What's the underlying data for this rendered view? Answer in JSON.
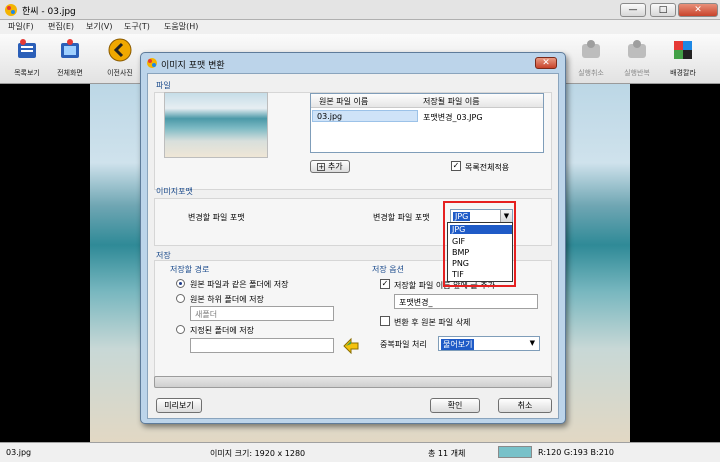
{
  "window": {
    "title": "한씨 - 03.jpg",
    "min_label": "—",
    "max_label": "□",
    "close_label": "✕"
  },
  "menu": [
    "파일(F)",
    "편집(E)",
    "보기(V)",
    "도구(T)",
    "도움말(H)"
  ],
  "toolbar": {
    "items": [
      {
        "label": "목록보기",
        "icon": "list-view-icon"
      },
      {
        "label": "전체화면",
        "icon": "fullscreen-icon"
      },
      {
        "label": "이전사진",
        "icon": "prev-photo-icon"
      },
      {
        "label": "실행취소",
        "icon": "undo-icon"
      },
      {
        "label": "실행반복",
        "icon": "redo-icon"
      },
      {
        "label": "배경칼라",
        "icon": "background-color-icon"
      }
    ]
  },
  "status": {
    "filename": "03.jpg",
    "image_size": "이미지 크기: 1920 x 1280",
    "count": "총 11 개체",
    "swatch_color": "#78c1c9",
    "rgb": "R:120 G:193 B:210"
  },
  "dialog": {
    "title": "이미지 포맷 변환",
    "close_label": "✕",
    "file_section": "파일",
    "list_headers": [
      "원본 파일 이름",
      "저장될 파일 이름"
    ],
    "list_rows": [
      {
        "source": "03.jpg",
        "target": "포맷변경_03.JPG"
      }
    ],
    "add_button": "추가",
    "add_plus": "+",
    "apply_all": {
      "label": "목록전체적용",
      "checked": "✓"
    },
    "format_section": "이미지포맷",
    "source_format_label": "변경할 파일 포맷",
    "target_format_label": "변경할 파일 포맷",
    "format_selected": "JPG",
    "format_options": [
      "JPG",
      "GIF",
      "BMP",
      "PNG",
      "TIF"
    ],
    "save_section": "저장",
    "save_path_title": "저장할 경로",
    "save_options": [
      "원본 파일과 같은 폴더에 저장",
      "원본 하위 폴더에 저장",
      "지정된 폴더에 저장"
    ],
    "subfolder_value": "새폴더",
    "save_options_title": "저장 옵션",
    "name_prefix": {
      "label": "저장할 파일 이름 앞에 글 추가",
      "checked": "✓"
    },
    "prefix_value": "포맷변경_",
    "delete_after": "변환 후 원본 파일 삭제",
    "dup_label": "중복파일 처리",
    "dup_value": "물어보기",
    "preview_button": "미리보기",
    "ok_button": "확인",
    "cancel_button": "취소"
  }
}
